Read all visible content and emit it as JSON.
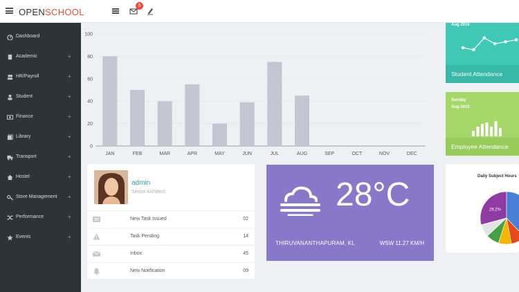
{
  "brand": {
    "part1": "OPEN",
    "part2": "SCHOOL"
  },
  "header": {
    "mail_badge": "5"
  },
  "sidebar": {
    "items": [
      {
        "label": "Dashboard",
        "icon": "dashboard-icon",
        "expandable": false
      },
      {
        "label": "Academic",
        "icon": "book-icon",
        "expandable": true
      },
      {
        "label": "HR/Payroll",
        "icon": "users-icon",
        "expandable": true
      },
      {
        "label": "Student",
        "icon": "user-icon",
        "expandable": true
      },
      {
        "label": "Finance",
        "icon": "money-icon",
        "expandable": true
      },
      {
        "label": "Library",
        "icon": "library-icon",
        "expandable": true
      },
      {
        "label": "Transport",
        "icon": "truck-icon",
        "expandable": true
      },
      {
        "label": "Hostel",
        "icon": "home-icon",
        "expandable": true
      },
      {
        "label": "Store Management",
        "icon": "key-icon",
        "expandable": true
      },
      {
        "label": "Performance",
        "icon": "shuffle-icon",
        "expandable": true
      },
      {
        "label": "Events",
        "icon": "star-icon",
        "expandable": true
      }
    ],
    "plus": "+"
  },
  "chart_data": {
    "type": "bar",
    "categories": [
      "JAN",
      "FEB",
      "MAR",
      "APR",
      "MAY",
      "JUN",
      "JUL",
      "AUG",
      "SEP",
      "OCT",
      "NOV",
      "DEC"
    ],
    "values": [
      80,
      50,
      40,
      55,
      20,
      39,
      75,
      45,
      null,
      null,
      null,
      null
    ],
    "ylim": [
      0,
      100
    ],
    "yticks": [
      "0",
      "20",
      "40",
      "60",
      "80",
      "100"
    ],
    "bar_color": "#c3c5d0",
    "grid": true
  },
  "profile": {
    "name": "admin",
    "role": "Senior Architect",
    "rows": [
      {
        "label": "New Task Issued",
        "value": "02",
        "icon": "list-icon"
      },
      {
        "label": "Task Pending",
        "value": "14",
        "icon": "warning-icon"
      },
      {
        "label": "Inbox",
        "value": "45",
        "icon": "envelope-icon"
      },
      {
        "label": "New Notification",
        "value": "09",
        "icon": "bell-icon"
      }
    ]
  },
  "weather": {
    "temperature": "28°C",
    "city": "THIRUVANANTHAPURAM, KL",
    "wind": "WSW 11.27 KM/H",
    "icon": "fog-cloud-icon",
    "color": "#8778c9"
  },
  "student_attendance": {
    "date": "Aug 2015",
    "title": "Student Attendance",
    "values": [
      35,
      30,
      60,
      45,
      50,
      55
    ],
    "color": "#3fc8b5"
  },
  "employee_attendance": {
    "day": "Sunday",
    "date": "Aug 2015",
    "title": "Employee Attendance",
    "values": [
      8,
      14,
      18,
      20,
      14,
      22,
      12
    ],
    "color": "#a5d868"
  },
  "daily_subject": {
    "title": "Daily Subject Hours",
    "slices": [
      {
        "value": 29.2,
        "label": "29.2%",
        "color": "#8e3ba4"
      },
      {
        "value": 38,
        "label": "",
        "color": "#4a7fd8"
      },
      {
        "value": 9,
        "label": "",
        "color": "#e64a19"
      },
      {
        "value": 8,
        "label": "",
        "color": "#f7b500"
      },
      {
        "value": 8,
        "label": "",
        "color": "#43a047"
      },
      {
        "value": 7.8,
        "label": "",
        "color": "#e4e4e4"
      }
    ]
  }
}
